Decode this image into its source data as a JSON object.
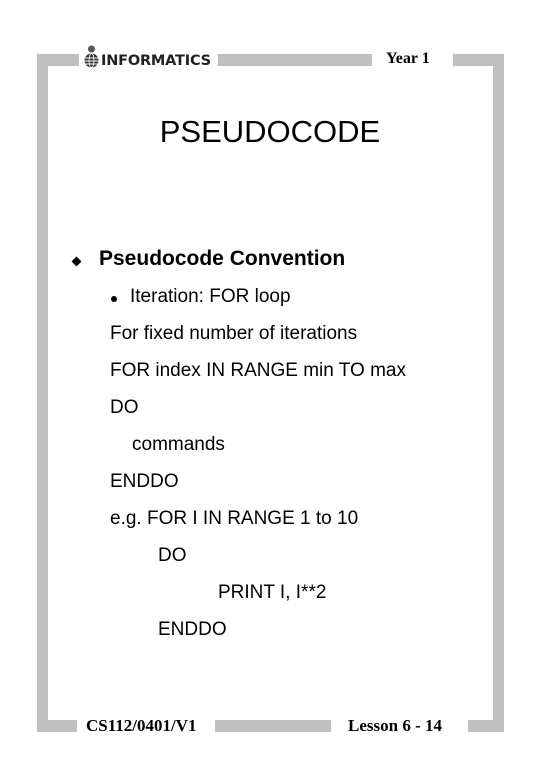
{
  "header": {
    "logo_text": "INFORMATICS",
    "logo_icon": "person-globe-icon",
    "year_label": "Year 1"
  },
  "slide": {
    "title": "PSEUDOCODE",
    "bullet": {
      "icon": "diamond-bullet-icon",
      "text": "Pseudocode Convention"
    },
    "sub_bullet": {
      "icon": "round-bullet-icon",
      "text": "Iteration: FOR loop"
    },
    "lines": [
      "For fixed number of iterations",
      "FOR index IN RANGE min TO max",
      "DO",
      "commands",
      "ENDDO",
      "e.g. FOR I IN RANGE 1 to 10",
      "DO",
      "PRINT I, I**2",
      "ENDDO"
    ]
  },
  "footer": {
    "course_code": "CS112/0401/V1",
    "lesson_page": "Lesson 6 - 14"
  },
  "colors": {
    "frame": "#c0c0c0",
    "text": "#000000",
    "background": "#ffffff"
  }
}
